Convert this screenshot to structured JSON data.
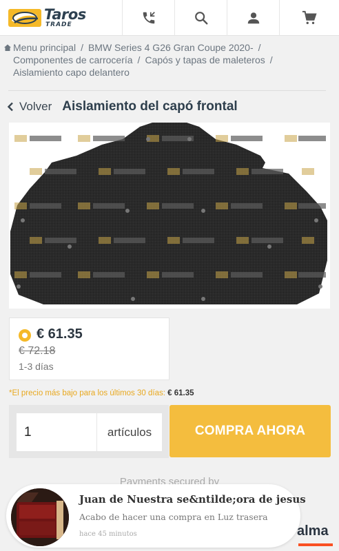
{
  "header": {
    "logo_text": "Taros",
    "logo_subtext": "TRADE",
    "icons": [
      "phone-icon",
      "search-icon",
      "user-icon",
      "cart-icon"
    ]
  },
  "breadcrumb": {
    "items": [
      "Menu principal",
      "BMW Series 4 G26 Gran Coupe 2020-",
      "Componentes de carrocería",
      "Capós y tapas de maleteros",
      "Aislamiento capo delantero"
    ],
    "separator": "/"
  },
  "nav": {
    "back_label": "Volver",
    "title": "Aislamiento del capó frontal"
  },
  "price_option": {
    "price": "€ 61.35",
    "old_price": "€ 72.18",
    "delivery": "1-3 días"
  },
  "lowest_price": {
    "label": "*El precio más bajo para los últimos 30 días:",
    "value": "€ 61.35"
  },
  "purchase": {
    "quantity": "1",
    "unit_label": "artículos",
    "buy_label": "COMPRA AHORA"
  },
  "payments_label": "Payments secured by",
  "toast": {
    "name": "Juan de Nuestra se&ntilde;ora de jesus",
    "message": "Acabo de hacer una compra en Luz trasera",
    "time": "hace 45 minutos"
  },
  "partner_logo": "alma",
  "colors": {
    "accent": "#f4bd3e",
    "title": "#2d3e4c",
    "lowest_price_text": "#e8a81f",
    "alma_bar": "#fa5022"
  }
}
